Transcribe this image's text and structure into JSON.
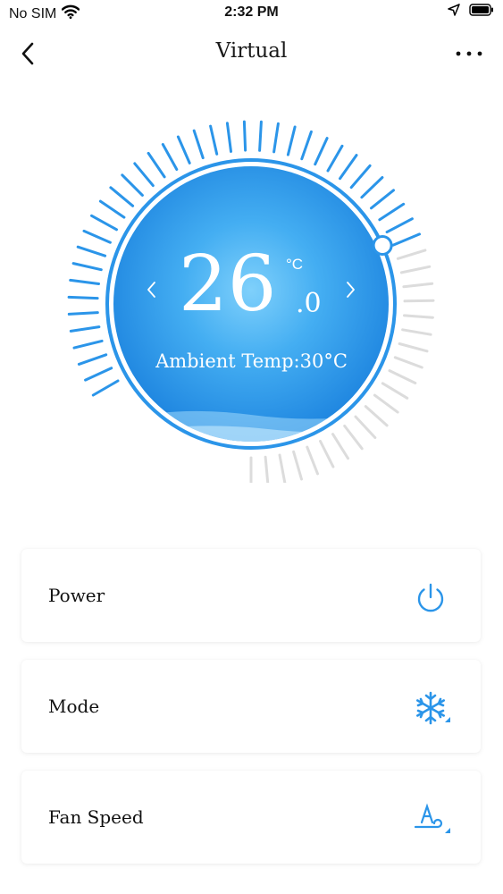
{
  "status_bar": {
    "carrier": "No SIM",
    "time": "2:32 PM"
  },
  "nav": {
    "title": "Virtual"
  },
  "thermostat": {
    "set_temp_whole": "26",
    "set_temp_unit": "°C",
    "set_temp_decimal": ".0",
    "ambient_label": "Ambient Temp:30°C",
    "accent_color": "#2b95e9",
    "inactive_tick_color": "#dcdcdc",
    "setpoint_fraction": 0.62
  },
  "controls": [
    {
      "label": "Power",
      "icon": "power-icon"
    },
    {
      "label": "Mode",
      "icon": "snowflake-icon"
    },
    {
      "label": "Fan Speed",
      "icon": "fan-auto-icon"
    }
  ]
}
